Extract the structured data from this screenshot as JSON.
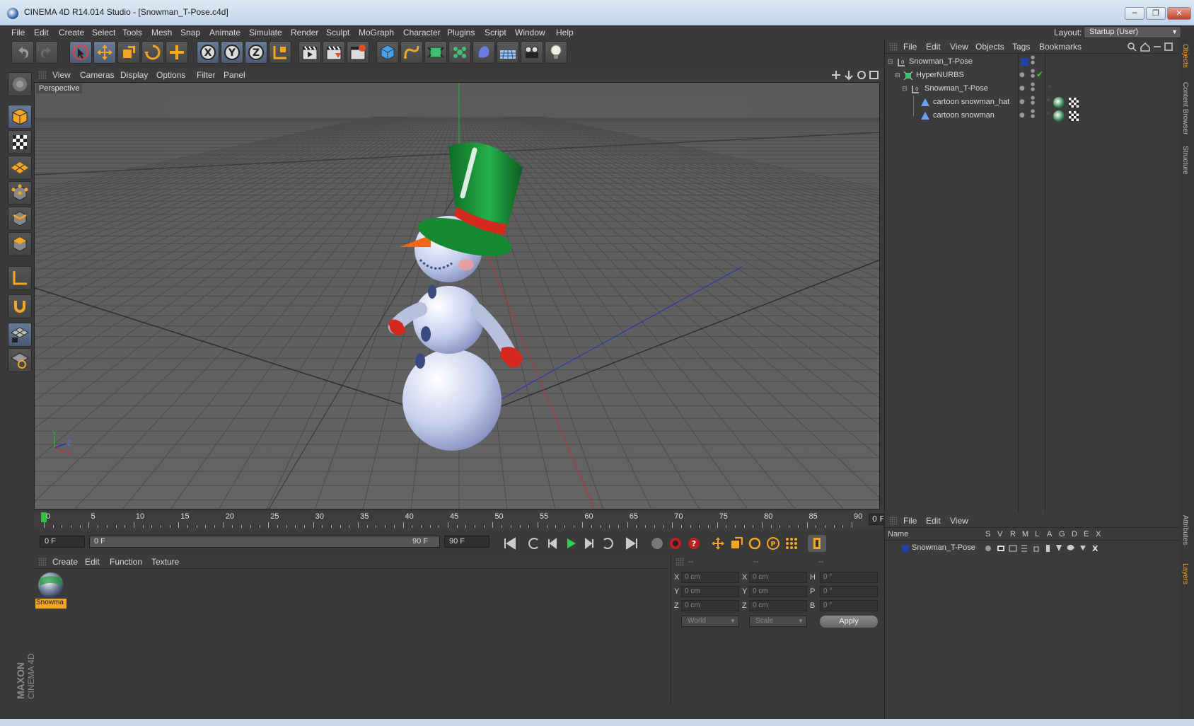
{
  "window": {
    "title": "CINEMA 4D R14.014 Studio - [Snowman_T-Pose.c4d]",
    "minimize": "─",
    "restore": "❐",
    "close": "✕"
  },
  "menubar": {
    "items": [
      "File",
      "Edit",
      "Create",
      "Select",
      "Tools",
      "Mesh",
      "Snap",
      "Animate",
      "Simulate",
      "Render",
      "Sculpt",
      "MoGraph",
      "Character",
      "Plugins",
      "Script",
      "Window",
      "Help"
    ],
    "layout_label": "Layout:",
    "layout_value": "Startup (User)"
  },
  "toolbar": {
    "axis_x": "X",
    "axis_y": "Y",
    "axis_z": "Z"
  },
  "viewport": {
    "menu": [
      "View",
      "Cameras",
      "Display",
      "Options",
      "Filter",
      "Panel"
    ],
    "label": "Perspective",
    "axis_y": "Y",
    "axis_z": "Z",
    "axis_x": "X"
  },
  "timeline": {
    "ticks": [
      "0",
      "5",
      "10",
      "15",
      "20",
      "25",
      "30",
      "35",
      "40",
      "45",
      "50",
      "55",
      "60",
      "65",
      "70",
      "75",
      "80",
      "85",
      "90"
    ],
    "current_frame": "0 F"
  },
  "transport": {
    "start_field": "0 F",
    "range_start": "0 F",
    "range_end": "90 F",
    "end_field": "90 F"
  },
  "material_manager": {
    "menu": [
      "Create",
      "Edit",
      "Function",
      "Texture"
    ],
    "material_name": "Snowma"
  },
  "coordinates": {
    "col1_header": "--",
    "col2_header": "--",
    "col3_header": "--",
    "rows": [
      {
        "l1": "X",
        "v1": "0 cm",
        "l2": "X",
        "v2": "0 cm",
        "l3": "H",
        "v3": "0 °"
      },
      {
        "l1": "Y",
        "v1": "0 cm",
        "l2": "Y",
        "v2": "0 cm",
        "l3": "P",
        "v3": "0 °"
      },
      {
        "l1": "Z",
        "v1": "0 cm",
        "l2": "Z",
        "v2": "0 cm",
        "l3": "B",
        "v3": "0 °"
      }
    ],
    "world": "World",
    "scale": "Scale",
    "apply": "Apply"
  },
  "objects": {
    "menu": [
      "File",
      "Edit",
      "View",
      "Objects",
      "Tags",
      "Bookmarks"
    ],
    "tree": [
      {
        "name": "Snowman_T-Pose"
      },
      {
        "name": "HyperNURBS"
      },
      {
        "name": "Snowman_T-Pose"
      },
      {
        "name": "cartoon snowman_hat"
      },
      {
        "name": "cartoon snowman"
      }
    ]
  },
  "layers": {
    "menu": [
      "File",
      "Edit",
      "View"
    ],
    "columns": [
      "Name",
      "S",
      "V",
      "R",
      "M",
      "L",
      "A",
      "G",
      "D",
      "E",
      "X"
    ],
    "rows": [
      {
        "name": "Snowman_T-Pose"
      }
    ]
  },
  "right_tabs": [
    "Objects",
    "Content Browser",
    "Structure",
    "Attributes",
    "Layers"
  ],
  "branding": {
    "maxon": "MAXON",
    "c4d": "CINEMA 4D"
  },
  "colors": {
    "accent_orange": "#f5a623",
    "snowman_green": "#1f9a3a",
    "mitten_red": "#d42a1e",
    "layer_blue": "#2244aa"
  }
}
